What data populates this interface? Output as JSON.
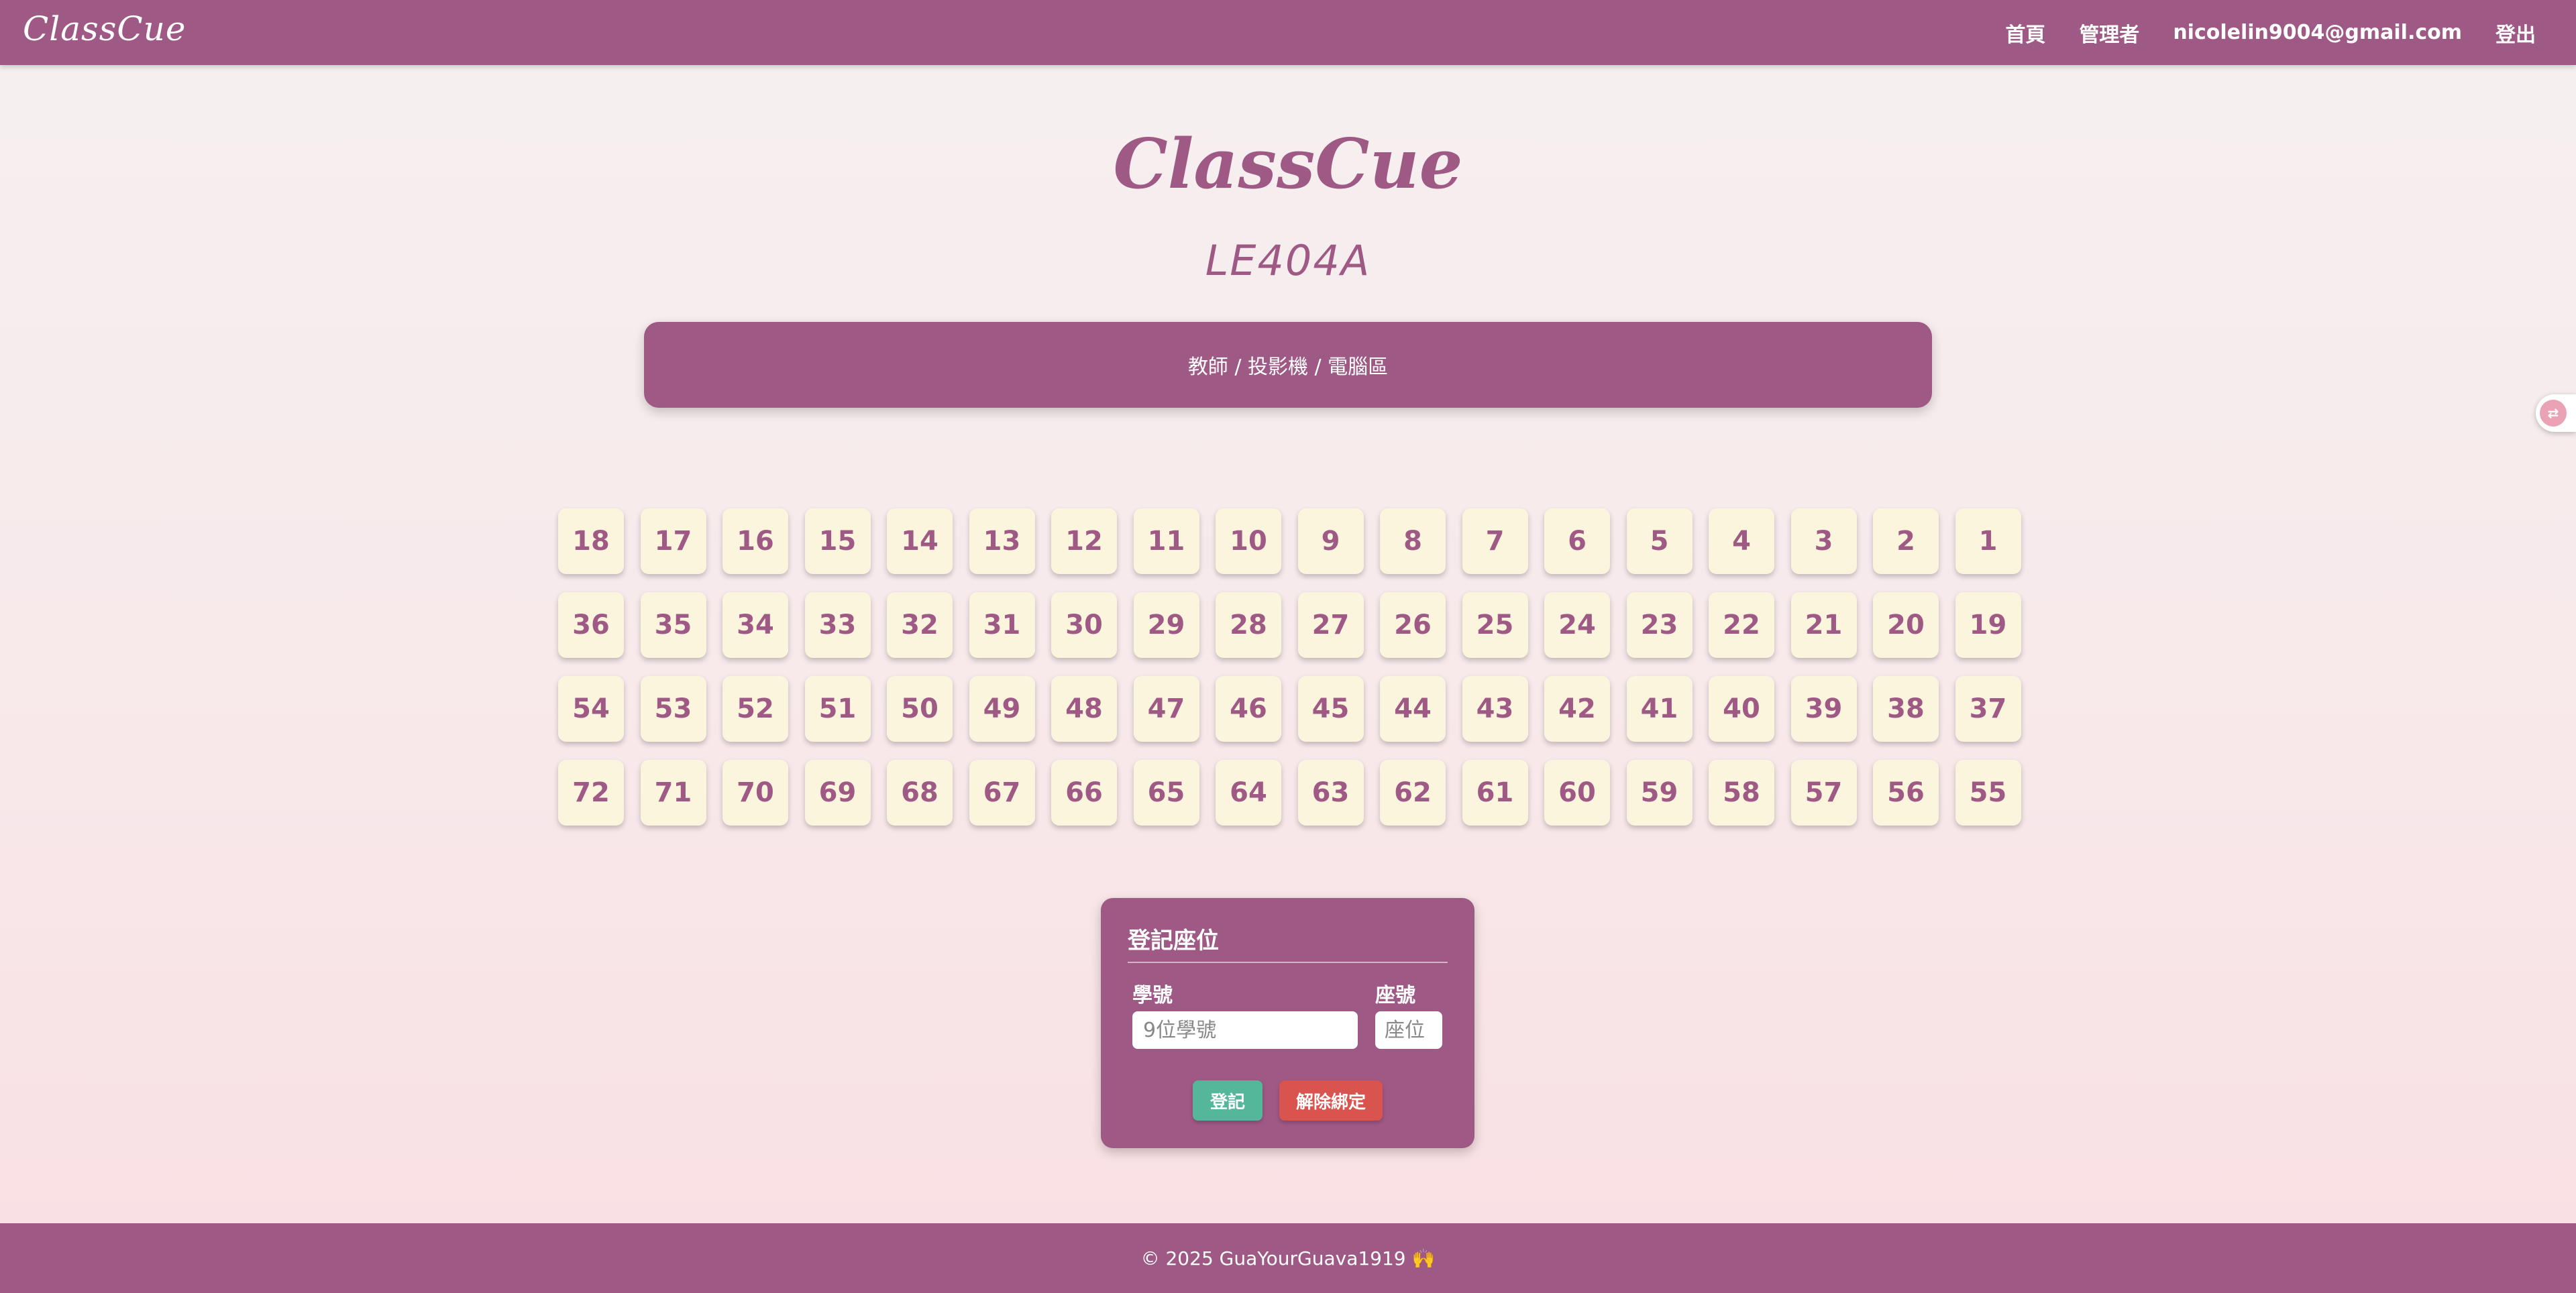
{
  "nav": {
    "brand": "ClassCue",
    "links": [
      "首頁",
      "管理者",
      "nicolelin9004@gmail.com",
      "登出"
    ]
  },
  "hero": {
    "title": "ClassCue",
    "room": "LE404A"
  },
  "front": {
    "label": "教師 / 投影機 / 電腦區"
  },
  "seats": [
    [
      "18",
      "17",
      "16",
      "15",
      "14",
      "13",
      "12",
      "11",
      "10",
      "9",
      "8",
      "7",
      "6",
      "5",
      "4",
      "3",
      "2",
      "1"
    ],
    [
      "36",
      "35",
      "34",
      "33",
      "32",
      "31",
      "30",
      "29",
      "28",
      "27",
      "26",
      "25",
      "24",
      "23",
      "22",
      "21",
      "20",
      "19"
    ],
    [
      "54",
      "53",
      "52",
      "51",
      "50",
      "49",
      "48",
      "47",
      "46",
      "45",
      "44",
      "43",
      "42",
      "41",
      "40",
      "39",
      "38",
      "37"
    ],
    [
      "72",
      "71",
      "70",
      "69",
      "68",
      "67",
      "66",
      "65",
      "64",
      "63",
      "62",
      "61",
      "60",
      "59",
      "58",
      "57",
      "56",
      "55"
    ]
  ],
  "register": {
    "title": "登記座位",
    "student_label": "學號",
    "student_placeholder": "9位學號",
    "seat_label": "座號",
    "seat_placeholder": "座位",
    "submit_label": "登記",
    "unbind_label": "解除綁定"
  },
  "translate_icon": "translate-icon",
  "colors": {
    "primary": "#9f5985",
    "seat_bg": "#fbf5de",
    "submit": "#55b79a",
    "unbind": "#d9534f"
  },
  "footer": {
    "text": "© 2025 GuaYourGuava1919 🙌"
  }
}
